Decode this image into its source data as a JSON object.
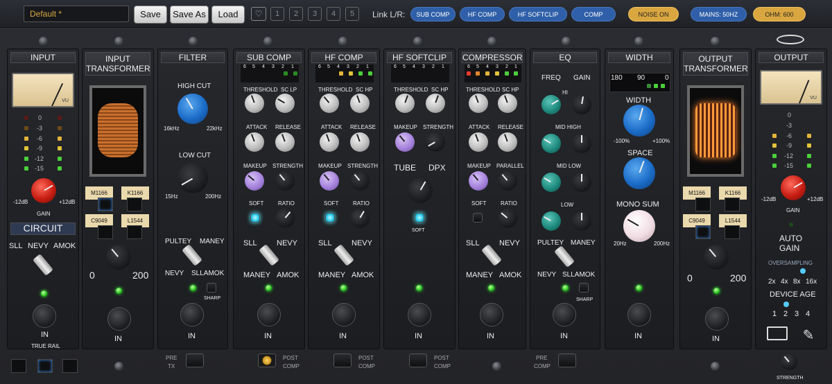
{
  "toolbar": {
    "preset": "Default *",
    "save": "Save",
    "save_as": "Save As",
    "load": "Load",
    "heart": "♡",
    "slots": [
      "1",
      "2",
      "3",
      "4",
      "5"
    ],
    "link_label": "Link L/R:"
  },
  "links": [
    "SUB COMP",
    "HF COMP",
    "HF SOFTCLIP",
    "COMP"
  ],
  "toggles": {
    "noise": "NOISE ON",
    "mains": "MAINS: 50HZ",
    "ohm": "OHM: 600"
  },
  "input": {
    "title": "INPUT",
    "vu": "VU",
    "meter": [
      "0",
      "-3",
      "-6",
      "-9",
      "-12",
      "-15"
    ],
    "gain_min": "-12dB",
    "gain_max": "+12dB",
    "gain": "GAIN",
    "circuit": "CIRCUIT",
    "circuit_opts": [
      "SLL",
      "NEVY",
      "AMOK"
    ],
    "in": "IN",
    "true_rail": "TRUE RAIL"
  },
  "in_tx": {
    "title": "INPUT TRANSFORMER",
    "t1": "M1166",
    "t2": "K1166",
    "t3": "C9049",
    "t4": "L1544",
    "min": "0",
    "max": "200",
    "in": "IN"
  },
  "filter": {
    "title": "FILTER",
    "high": "HIGH CUT",
    "h_min": "16kHz",
    "h_max": "22kHz",
    "low": "LOW CUT",
    "l_min": "15Hz",
    "l_max": "200Hz",
    "opts": [
      "PULTEY",
      "MANEY",
      "NEVY",
      "SLLAMOK"
    ],
    "sharp": "SHARP",
    "in": "IN",
    "pre": "PRE",
    "tx": "TX"
  },
  "sub": {
    "title": "SUB COMP",
    "gr": [
      "6",
      "5",
      "4",
      "3",
      "2",
      "1"
    ],
    "threshold": "THRESHOLD",
    "sc": "SC LP",
    "attack": "ATTACK",
    "release": "RELEASE",
    "makeup": "MAKEUP",
    "strength": "STRENGTH",
    "soft": "SOFT",
    "ratio": "RATIO",
    "opts": [
      "SLL",
      "NEVY",
      "MANEY",
      "AMOK"
    ],
    "in": "IN",
    "post": "POST",
    "comp": "COMP"
  },
  "hf": {
    "title": "HF COMP",
    "gr": [
      "6",
      "5",
      "4",
      "3",
      "2",
      "1"
    ],
    "threshold": "THRESHOLD",
    "sc": "SC HP",
    "attack": "ATTACK",
    "release": "RELEASE",
    "makeup": "MAKEUP",
    "strength": "STRENGTH",
    "soft": "SOFT",
    "ratio": "RATIO",
    "opts": [
      "SLL",
      "NEVY",
      "MANEY",
      "AMOK"
    ],
    "in": "IN",
    "post": "POST",
    "comp": "COMP"
  },
  "hfsc": {
    "title": "HF SOFTCLIP",
    "gr": [
      "6",
      "5",
      "4",
      "3",
      "2",
      "1"
    ],
    "threshold": "THRESHOLD",
    "sc": "SC HP",
    "makeup": "MAKEUP",
    "strength": "STRENGTH",
    "tube": "TUBE",
    "dpx": "DPX",
    "soft": "SOFT",
    "in": "IN",
    "post": "POST",
    "comp": "COMP"
  },
  "comp": {
    "title": "COMPRESSOR",
    "gr": [
      "6",
      "5",
      "4",
      "3",
      "2",
      "1"
    ],
    "threshold": "THRESHOLD",
    "sc": "SC HP",
    "attack": "ATTACK",
    "release": "RELEASE",
    "makeup": "MAKEUP",
    "parallel": "PARALLEL",
    "soft": "SOFT",
    "ratio": "RATIO",
    "opts": [
      "SLL",
      "NEVY",
      "MANEY",
      "AMOK"
    ],
    "in": "IN"
  },
  "eq": {
    "title": "EQ",
    "freq": "FREQ",
    "gain": "GAIN",
    "bands": [
      "HI",
      "MID HIGH",
      "MID LOW",
      "LOW"
    ],
    "opts": [
      "PULTEY",
      "MANEY",
      "NEVY",
      "SLLAMOK"
    ],
    "sharp": "SHARP",
    "in": "IN",
    "pre": "PRE",
    "comp": "COMP"
  },
  "width": {
    "title": "WIDTH",
    "scale": [
      "180",
      "90",
      "0"
    ],
    "width": "WIDTH",
    "w_min": "-100%",
    "w_max": "+100%",
    "space": "SPACE",
    "mono": "MONO SUM",
    "m_min": "20Hz",
    "m_max": "200Hz",
    "in": "IN"
  },
  "out_tx": {
    "title": "OUTPUT TRANSFORMER",
    "t1": "M1166",
    "t2": "K1166",
    "t3": "C9049",
    "t4": "L1544",
    "min": "0",
    "max": "200",
    "in": "IN"
  },
  "output": {
    "title": "OUTPUT",
    "vu": "VU",
    "meter": [
      "0",
      "-3",
      "-6",
      "-9",
      "-12",
      "-15"
    ],
    "gain_min": "-12dB",
    "gain_max": "+12dB",
    "gain": "GAIN",
    "auto": "AUTO",
    "auto2": "GAIN",
    "os": "OVERSAMPLING",
    "os_opts": [
      "2x",
      "4x",
      "8x",
      "16x"
    ],
    "age": "DEVICE AGE",
    "age_opts": [
      "1",
      "2",
      "3",
      "4"
    ],
    "strength": "STRENGTH"
  }
}
